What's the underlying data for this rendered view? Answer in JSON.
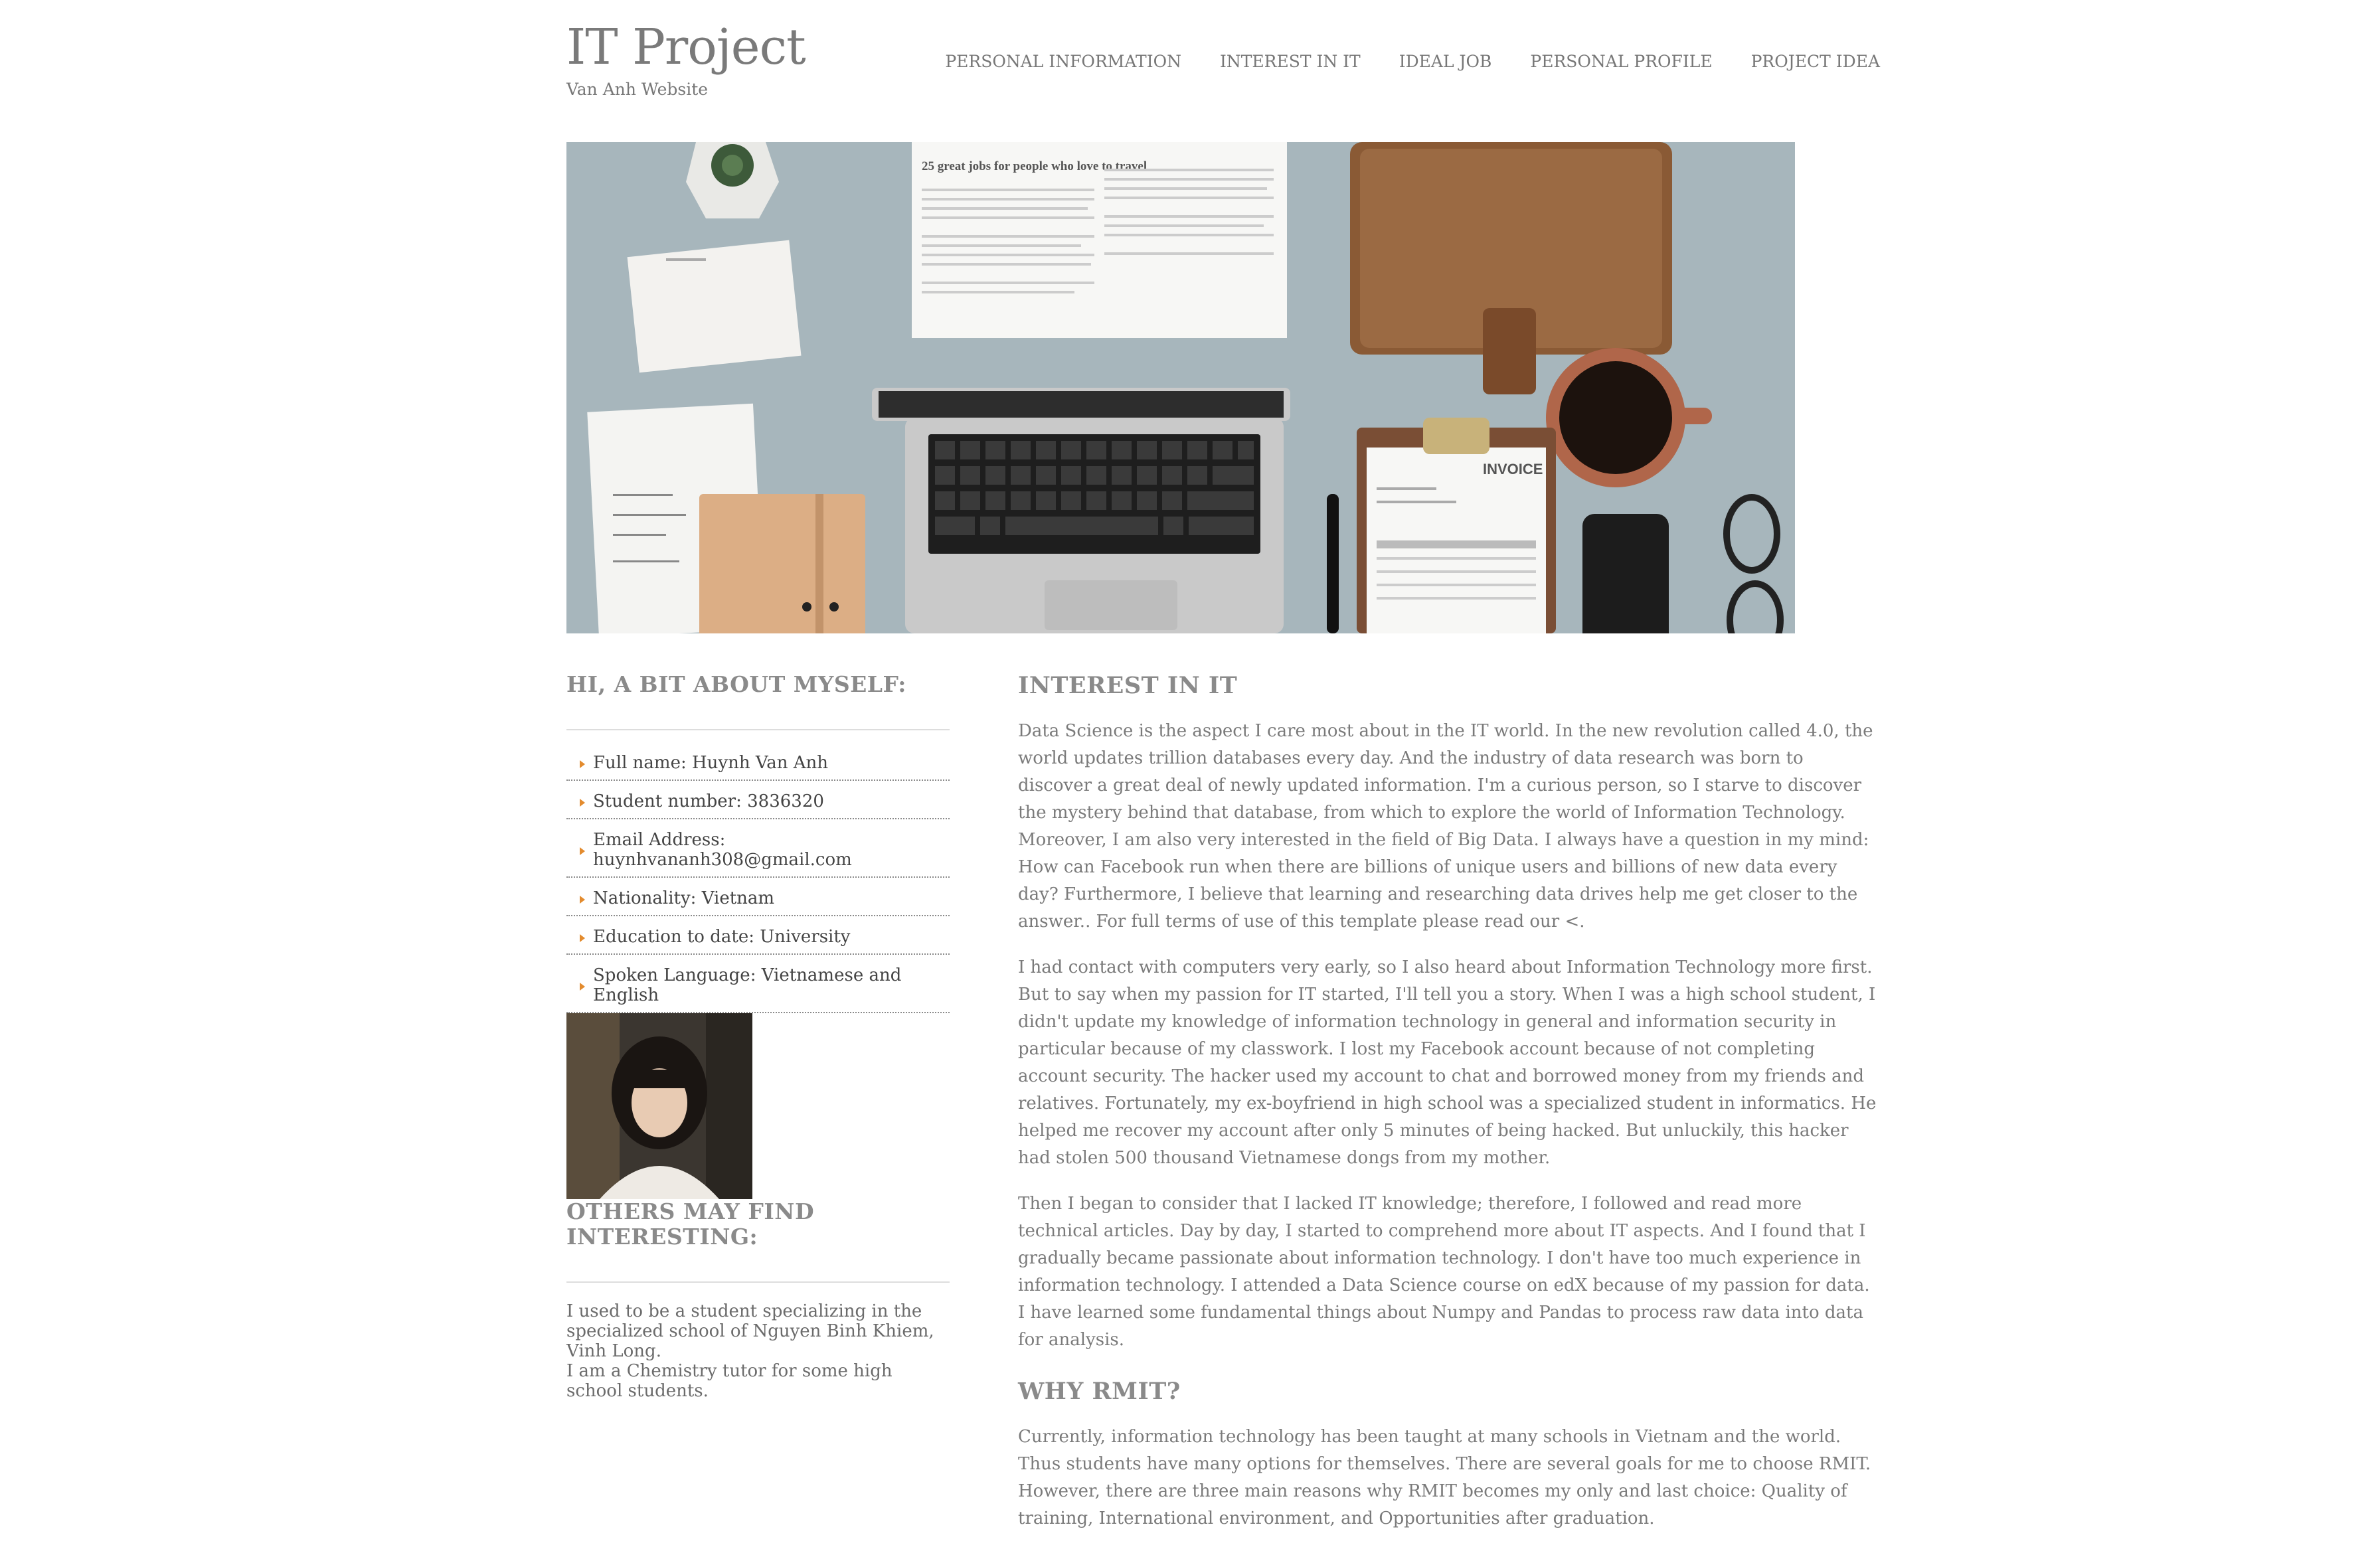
{
  "header": {
    "title": "IT Project",
    "subtitle": "Van Anh Website"
  },
  "nav": [
    {
      "label": "PERSONAL INFORMATION"
    },
    {
      "label": "INTEREST IN IT"
    },
    {
      "label": "IDEAL JOB"
    },
    {
      "label": "PERSONAL PROFILE"
    },
    {
      "label": "PROJECT IDEA"
    }
  ],
  "sidebar": {
    "about_heading": "HI, A BIT ABOUT MYSELF:",
    "items": [
      {
        "label": "Full name: Huynh Van Anh"
      },
      {
        "label": "Student number: 3836320"
      },
      {
        "label": "Email Address:",
        "value": "huynhvananh308@gmail.com"
      },
      {
        "label": "Nationality: Vietnam"
      },
      {
        "label": "Education to date: University"
      },
      {
        "label": "Spoken Language: Vietnamese and English"
      }
    ],
    "others_heading": "OTHERS MAY FIND INTERESTING:",
    "others_lines": [
      "I used to be a student specializing in the specialized school of Nguyen Binh Khiem, Vinh Long.",
      "I am a Chemistry tutor for some high school students."
    ]
  },
  "main": {
    "heading1": "INTEREST IN IT",
    "paragraphs1": [
      "Data Science is the aspect I care most about in the IT world. In the new revolution called 4.0, the world updates trillion databases every day. And the industry of data research was born to discover a great deal of newly updated information. I'm a curious person, so I starve to discover the mystery behind that database, from which to explore the world of Information Technology. Moreover, I am also very interested in the field of Big Data. I always have a question in my mind: How can Facebook run when there are billions of unique users and billions of new data every day? Furthermore, I believe that learning and researching data drives help me get closer to the answer.. For full terms of use of this template please read our <.",
      "I had contact with computers very early, so I also heard about Information Technology more first. But to say when my passion for IT started, I'll tell you a story. When I was a high school student, I didn't update my knowledge of information technology in general and information security in particular because of my classwork. I lost my Facebook account because of not completing account security. The hacker used my account to chat and borrowed money from my friends and relatives. Fortunately, my ex-boyfriend in high school was a specialized student in informatics. He helped me recover my account after only 5 minutes of being hacked. But unluckily, this hacker had stolen 500 thousand Vietnamese dongs from my mother.",
      "Then I began to consider that I lacked IT knowledge; therefore, I followed and read more technical articles. Day by day, I started to comprehend more about IT aspects. And I found that I gradually became passionate about information technology. I don't have too much experience in information technology. I attended a Data Science course on edX because of my passion for data. I have learned some fundamental things about Numpy and Pandas to process raw data into data for analysis."
    ],
    "heading2": "WHY RMIT?",
    "paragraphs2": [
      "Currently, information technology has been taught at many schools in Vietnam and the world. Thus students have many options for themselves. There are several goals for me to choose RMIT. However, there are three main reasons why RMIT becomes my only and last choice: Quality of training, International environment, and Opportunities after graduation."
    ]
  },
  "hero_image": {
    "description_icon": "desk-flatlay-image",
    "printed_text": "25 great jobs for people who love to travel",
    "printed_text_2": "INVOICE"
  },
  "colors": {
    "accent_bullet": "#e38b2e",
    "heading": "#8a8a8a",
    "body_text": "#7a7a7a",
    "background": "#ffffff"
  }
}
